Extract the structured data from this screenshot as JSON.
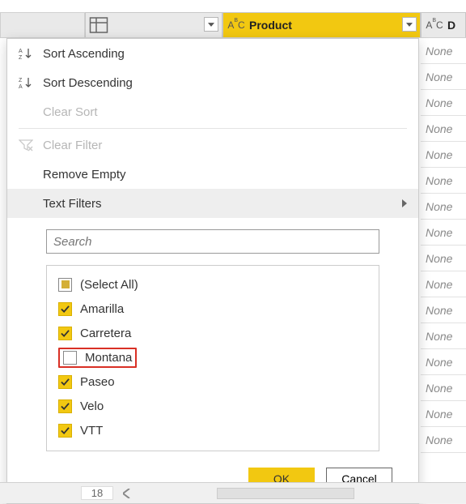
{
  "columns": {
    "product": {
      "label": "Product",
      "type_icon": "abc"
    },
    "next": {
      "label": "D",
      "type_icon": "abc"
    }
  },
  "menu": {
    "sort_asc": "Sort Ascending",
    "sort_desc": "Sort Descending",
    "clear_sort": "Clear Sort",
    "clear_filter": "Clear Filter",
    "remove_empty": "Remove Empty",
    "text_filters": "Text Filters"
  },
  "search": {
    "placeholder": "Search"
  },
  "filter_values": {
    "select_all": "(Select All)",
    "items": [
      {
        "label": "Amarilla",
        "checked": true
      },
      {
        "label": "Carretera",
        "checked": true
      },
      {
        "label": "Montana",
        "checked": false
      },
      {
        "label": "Paseo",
        "checked": true
      },
      {
        "label": "Velo",
        "checked": true
      },
      {
        "label": "VTT",
        "checked": true
      }
    ]
  },
  "buttons": {
    "ok": "OK",
    "cancel": "Cancel"
  },
  "data_column": {
    "cells": [
      "None",
      "None",
      "None",
      "None",
      "None",
      "None",
      "None",
      "None",
      "None",
      "None",
      "None",
      "None",
      "None",
      "None",
      "None",
      "None"
    ]
  },
  "bottom": {
    "rownum": "18"
  }
}
